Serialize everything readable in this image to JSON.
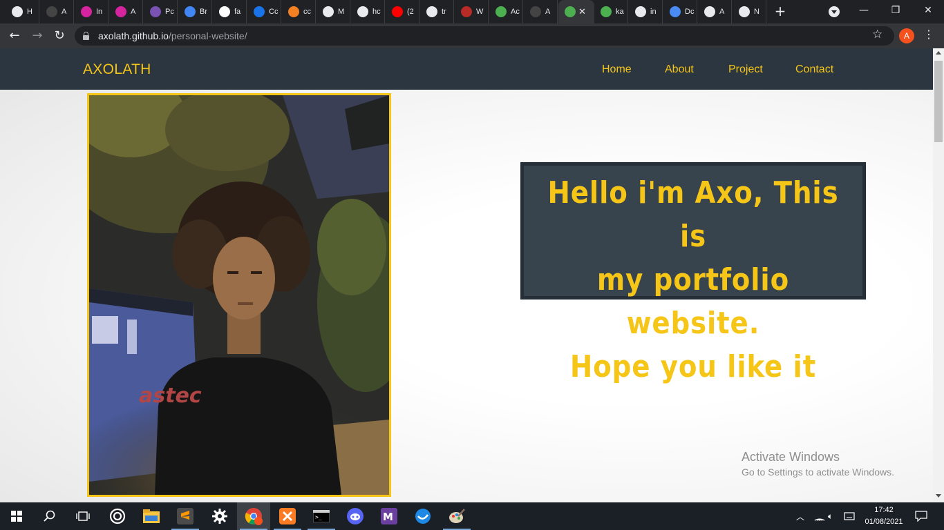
{
  "browser": {
    "tabs": [
      {
        "icon": "globe-icon",
        "title": "H",
        "color": "#e8eaed"
      },
      {
        "icon": "github-icon",
        "title": "A",
        "color": "#444"
      },
      {
        "icon": "instagram-icon",
        "title": "In",
        "color": "#d6249f"
      },
      {
        "icon": "instagram-icon",
        "title": "A",
        "color": "#d6249f"
      },
      {
        "icon": "bootstrap-icon",
        "title": "Pc",
        "color": "#7952b3"
      },
      {
        "icon": "brand-icon",
        "title": "Br",
        "color": "#4285f4"
      },
      {
        "icon": "flag-icon",
        "title": "fa",
        "color": "#ffffff"
      },
      {
        "icon": "canva-icon",
        "title": "Cc",
        "color": "#1a73e8"
      },
      {
        "icon": "stackoverflow-icon",
        "title": "cc",
        "color": "#f48024"
      },
      {
        "icon": "globe-icon",
        "title": "M",
        "color": "#e8eaed"
      },
      {
        "icon": "google-icon",
        "title": "hc",
        "color": "#e8eaed"
      },
      {
        "icon": "youtube-icon",
        "title": "(2",
        "color": "#ff0000"
      },
      {
        "icon": "google-icon",
        "title": "tr",
        "color": "#e8eaed"
      },
      {
        "icon": "quora-icon",
        "title": "W",
        "color": "#b92b27"
      },
      {
        "icon": "virus-icon",
        "title": "Ac",
        "color": "#4caf50"
      },
      {
        "icon": "github-icon",
        "title": "A",
        "color": "#444"
      },
      {
        "icon": "virus-icon",
        "title": "",
        "color": "#4caf50",
        "active": true
      },
      {
        "icon": "virus-icon",
        "title": "ka",
        "color": "#4caf50"
      },
      {
        "icon": "google-icon",
        "title": "in",
        "color": "#e8eaed"
      },
      {
        "icon": "heart-icon",
        "title": "Dc",
        "color": "#4a8af4"
      },
      {
        "icon": "globe-icon",
        "title": "A",
        "color": "#e8eaed"
      },
      {
        "icon": "chrome-icon",
        "title": "N",
        "color": "#e8eaed"
      }
    ],
    "close_glyph": "✕",
    "new_tab_glyph": "+",
    "window_controls": {
      "minimize": "—",
      "restore": "❐",
      "close": "✕"
    },
    "url_host": "axolath.github.io",
    "url_path": "/personal-website/",
    "profile_initial": "A"
  },
  "site": {
    "brand": "AXOLATH",
    "nav": [
      "Home",
      "About",
      "Project",
      "Contact"
    ],
    "hero_lines": [
      "Hello i'm Axo, This is",
      "my portfolio website.",
      "Hope you like it"
    ],
    "shirt_text": "astec",
    "accent_color": "#f5c518",
    "nav_background": "#2c3640"
  },
  "watermark": {
    "title": "Activate Windows",
    "subtitle": "Go to Settings to activate Windows."
  },
  "taskbar": {
    "apps": [
      "windows-start-icon",
      "search-icon",
      "task-view-icon",
      "cortana-icon",
      "file-explorer-icon",
      "sublime-text-icon",
      "settings-icon",
      "chrome-icon",
      "xampp-icon",
      "terminal-icon",
      "discord-icon",
      "marvin-icon",
      "web-icon",
      "paint-icon"
    ],
    "time": "17:42",
    "date": "01/08/2021"
  }
}
